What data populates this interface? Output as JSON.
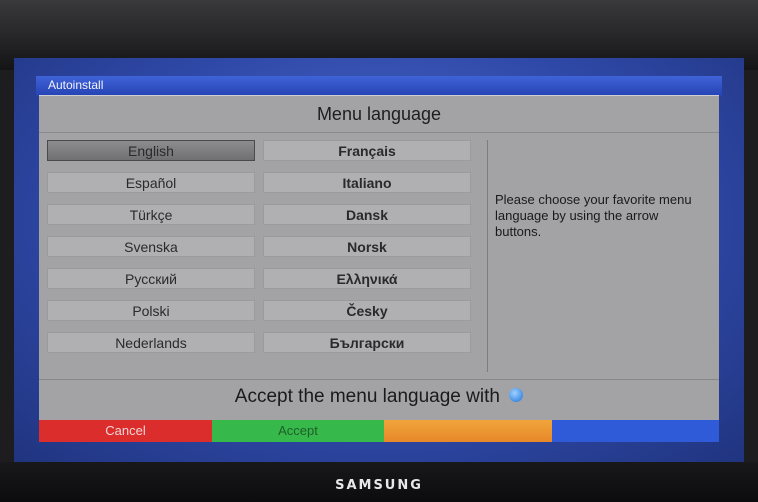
{
  "window": {
    "title": "Autoinstall"
  },
  "dialog": {
    "header": "Menu language",
    "languages_col1": [
      "English",
      "Español",
      "Türkçe",
      "Svenska",
      "Русский",
      "Polski",
      "Nederlands"
    ],
    "languages_col2": [
      "Français",
      "Italiano",
      "Dansk",
      "Norsk",
      "Ελληνικά",
      "Česky",
      "Български"
    ],
    "selected": "English",
    "info_text": "Please choose your favorite menu language by using the arrow buttons.",
    "accept_text": "Accept the menu language with"
  },
  "color_buttons": {
    "red_label": "Cancel",
    "green_label": "Accept",
    "yellow_label": "",
    "blue_label": ""
  },
  "brand": "SAMSUNG",
  "colors": {
    "red": "#dc2d2d",
    "green": "#36b94a",
    "yellow": "#f0a53c",
    "blue": "#2f5ad8",
    "dialog_bg": "#a3a3a5"
  }
}
